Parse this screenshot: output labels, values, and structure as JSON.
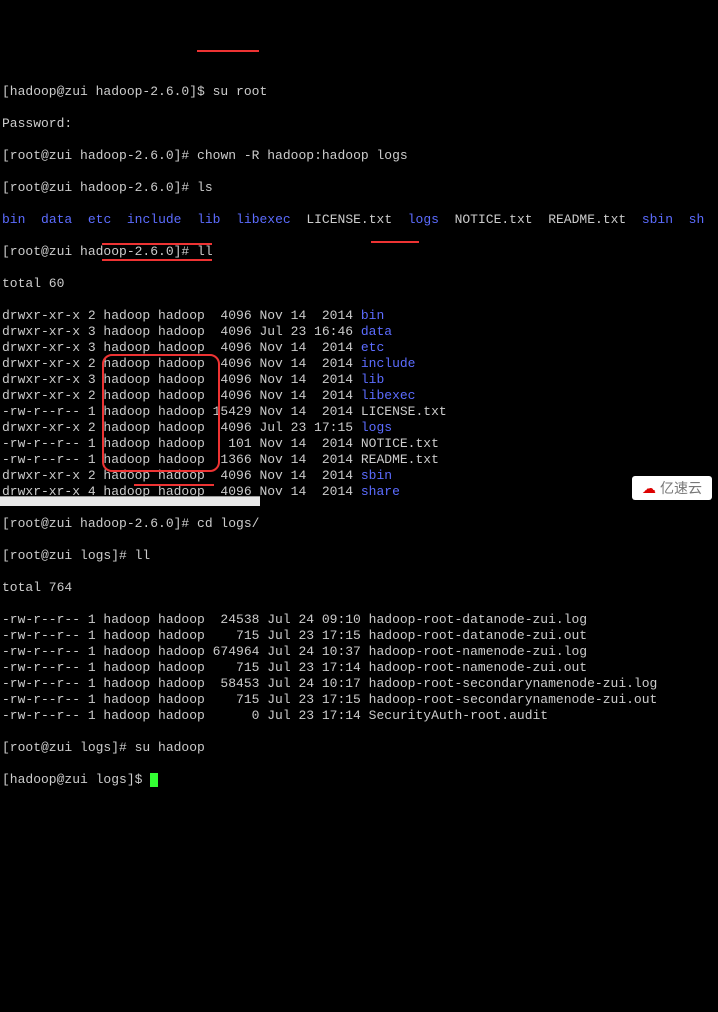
{
  "lines": {
    "l0": "[hadoop@zui hadoop-2.6.0]$ su root",
    "l1": "Password:",
    "l2p": "[root@zui hadoop-2.6.0]# ",
    "l2c": "chown -R hadoop:hadoop logs",
    "l3": "[root@zui hadoop-2.6.0]# ls",
    "l5": "[root@zui hadoop-2.6.0]# ll",
    "l6": "total 60",
    "l17": "[root@zui hadoop-2.6.0]# cd logs/",
    "l18": "[root@zui logs]# ll",
    "l19": "total 764",
    "l27": "[root@zui logs]# su hadoop",
    "l28": "[hadoop@zui logs]$ "
  },
  "ls": {
    "c0": "bin",
    "c1": "data",
    "c2": "etc",
    "c3": "include",
    "c4": "lib",
    "c5": "libexec",
    "c6": "LICENSE.txt",
    "c7": "logs",
    "c8": "NOTICE.txt",
    "c9": "README.txt",
    "c10": "sbin",
    "c11": "sh"
  },
  "ll": [
    {
      "perm": "drwxr-xr-x 2 hadoop hadoop  4096 Nov 14  2014 ",
      "name": "bin",
      "cls": "dir"
    },
    {
      "perm": "drwxr-xr-x 3 hadoop hadoop  4096 Jul 23 16:46 ",
      "name": "data",
      "cls": "dir"
    },
    {
      "perm": "drwxr-xr-x 3 hadoop hadoop  4096 Nov 14  2014 ",
      "name": "etc",
      "cls": "dir"
    },
    {
      "perm": "drwxr-xr-x 2 hadoop hadoop  4096 Nov 14  2014 ",
      "name": "include",
      "cls": "dir"
    },
    {
      "perm": "drwxr-xr-x 3 hadoop hadoop  4096 Nov 14  2014 ",
      "name": "lib",
      "cls": "dir"
    },
    {
      "perm": "drwxr-xr-x 2 hadoop hadoop  4096 Nov 14  2014 ",
      "name": "libexec",
      "cls": "dir"
    },
    {
      "perm": "-rw-r--r-- 1 hadoop hadoop 15429 Nov 14  2014 ",
      "name": "LICENSE.txt",
      "cls": "file"
    },
    {
      "perm": "drwxr-xr-x 2 hadoop hadoop  4096 Jul 23 17:15 ",
      "name": "logs",
      "cls": "dir"
    },
    {
      "perm": "-rw-r--r-- 1 hadoop hadoop   101 Nov 14  2014 ",
      "name": "NOTICE.txt",
      "cls": "file"
    },
    {
      "perm": "-rw-r--r-- 1 hadoop hadoop  1366 Nov 14  2014 ",
      "name": "README.txt",
      "cls": "file"
    },
    {
      "perm": "drwxr-xr-x 2 hadoop hadoop  4096 Nov 14  2014 ",
      "name": "sbin",
      "cls": "dir"
    },
    {
      "perm": "drwxr-xr-x 4 hadoop hadoop  4096 Nov 14  2014 ",
      "name": "share",
      "cls": "dir"
    }
  ],
  "ll2": [
    {
      "perm": "-rw-r--r-- 1 hadoop hadoop  24538 Jul 24 09:10 ",
      "name": "hadoop-root-datanode-zui.log",
      "cls": "file"
    },
    {
      "perm": "-rw-r--r-- 1 hadoop hadoop    715 Jul 23 17:15 ",
      "name": "hadoop-root-datanode-zui.out",
      "cls": "file"
    },
    {
      "perm": "-rw-r--r-- 1 hadoop hadoop 674964 Jul 24 10:37 ",
      "name": "hadoop-root-namenode-zui.log",
      "cls": "file"
    },
    {
      "perm": "-rw-r--r-- 1 hadoop hadoop    715 Jul 23 17:14 ",
      "name": "hadoop-root-namenode-zui.out",
      "cls": "file"
    },
    {
      "perm": "-rw-r--r-- 1 hadoop hadoop  58453 Jul 24 10:17 ",
      "name": "hadoop-root-secondarynamenode-zui.log",
      "cls": "file"
    },
    {
      "perm": "-rw-r--r-- 1 hadoop hadoop    715 Jul 23 17:15 ",
      "name": "hadoop-root-secondarynamenode-zui.out",
      "cls": "file"
    },
    {
      "perm": "-rw-r--r-- 1 hadoop hadoop      0 Jul 23 17:14 ",
      "name": "SecurityAuth-root.audit",
      "cls": "file"
    }
  ],
  "watermark": "亿速云"
}
